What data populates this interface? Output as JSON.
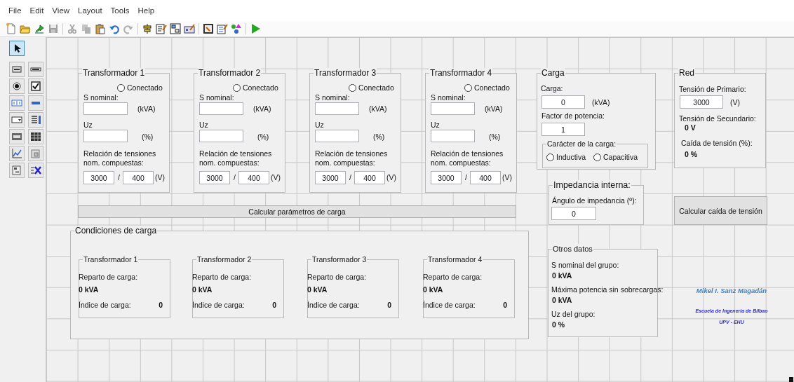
{
  "menu": [
    "File",
    "Edit",
    "View",
    "Layout",
    "Tools",
    "Help"
  ],
  "toolbar_groups": [
    {
      "buttons": [
        {
          "kind": "new",
          "disabled": false
        },
        {
          "kind": "open",
          "disabled": false
        },
        {
          "kind": "export",
          "disabled": false
        },
        {
          "kind": "save",
          "disabled": true
        }
      ]
    },
    {
      "buttons": [
        {
          "kind": "cut",
          "disabled": true
        },
        {
          "kind": "copy",
          "disabled": true
        },
        {
          "kind": "paste",
          "disabled": false
        },
        {
          "kind": "undo",
          "disabled": false
        },
        {
          "kind": "redo",
          "disabled": true
        }
      ]
    },
    {
      "buttons": [
        {
          "kind": "align",
          "disabled": false
        },
        {
          "kind": "menu-editor",
          "disabled": false
        },
        {
          "kind": "tab-order",
          "disabled": false
        },
        {
          "kind": "toolbar-editor",
          "disabled": false
        }
      ]
    },
    {
      "buttons": [
        {
          "kind": "editor",
          "disabled": false
        },
        {
          "kind": "inspector",
          "disabled": false
        },
        {
          "kind": "browser",
          "disabled": false
        }
      ]
    },
    {
      "buttons": [
        {
          "kind": "run",
          "disabled": false
        }
      ]
    }
  ],
  "palette_tools": [
    {
      "kind": "select",
      "selected": true
    },
    {
      "kind": "push-button",
      "selected": false
    },
    {
      "kind": "slider",
      "selected": false
    },
    {
      "kind": "radio",
      "selected": false
    },
    {
      "kind": "checkbox",
      "selected": false
    },
    {
      "kind": "edit",
      "selected": false
    },
    {
      "kind": "static-text",
      "selected": false
    },
    {
      "kind": "popup",
      "selected": false
    },
    {
      "kind": "listbox",
      "selected": false
    },
    {
      "kind": "toggle",
      "selected": false
    },
    {
      "kind": "table",
      "selected": false
    },
    {
      "kind": "axes",
      "selected": false
    },
    {
      "kind": "panel",
      "selected": false
    },
    {
      "kind": "button-group",
      "selected": false
    },
    {
      "kind": "activex",
      "selected": false
    }
  ],
  "transformers": [
    {
      "title": "Transformador 1",
      "connected_label": "Conectado",
      "connected": false,
      "s_nominal_label": "S nominal:",
      "s_nominal_unit": "(kVA)",
      "uz_label": "Uz",
      "uz_unit": "(%)",
      "ratio_label": "Relación de tensiones nom. compuestas:",
      "primary": "3000",
      "separator": "/",
      "secondary": "400",
      "ratio_unit": "(V)"
    },
    {
      "title": "Transformador 2",
      "connected_label": "Conectado",
      "connected": false,
      "s_nominal_label": "S nominal:",
      "s_nominal_unit": "(kVA)",
      "uz_label": "Uz",
      "uz_unit": "(%)",
      "ratio_label": "Relación de tensiones nom. compuestas:",
      "primary": "3000",
      "separator": "/",
      "secondary": "400",
      "ratio_unit": "(V)"
    },
    {
      "title": "Transformador 3",
      "connected_label": "Conectado",
      "connected": false,
      "s_nominal_label": "S nominal:",
      "s_nominal_unit": "(kVA)",
      "uz_label": "Uz",
      "uz_unit": "(%)",
      "ratio_label": "Relación de tensiones nom. compuestas:",
      "primary": "3000",
      "separator": "/",
      "secondary": "400",
      "ratio_unit": "(V)"
    },
    {
      "title": "Transformador 4",
      "connected_label": "Conectado",
      "connected": false,
      "s_nominal_label": "S nominal:",
      "s_nominal_unit": "(kVA)",
      "uz_label": "Uz",
      "uz_unit": "(%)",
      "ratio_label": "Relación de tensiones nom. compuestas:",
      "primary": "3000",
      "separator": "/",
      "secondary": "400",
      "ratio_unit": "(V)"
    }
  ],
  "carga": {
    "title": "Carga",
    "load_label": "Carga:",
    "load_value": "0",
    "load_unit": "(kVA)",
    "pf_label": "Factor de potencia:",
    "pf_value": "1",
    "character": {
      "title": "Carácter de la carga:",
      "options": [
        {
          "label": "Inductiva",
          "selected": false
        },
        {
          "label": "Capacitiva",
          "selected": false
        }
      ]
    }
  },
  "red": {
    "title": "Red",
    "primary_label": "Tensión de Primario:",
    "primary_value": "3000",
    "primary_unit": "(V)",
    "secondary_label": "Tensión de Secundario:",
    "secondary_value": "0 V",
    "drop_label": "Caída de tensión (%):",
    "drop_value": "0 %"
  },
  "calc_load_button": "Calcular parámetros de carga",
  "impedance": {
    "title": "Impedancia interna:",
    "angle_label": "Ángulo de impedancia (º):",
    "angle_value": "0"
  },
  "calc_drop_button": "Calcular caída de tensión",
  "conditions": {
    "title": "Condiciones de carga",
    "panels": [
      {
        "title": "Transformador 1",
        "share_label": "Reparto de carga:",
        "share_value": "0 kVA",
        "index_label": "Índice de carga:",
        "index_value": "0"
      },
      {
        "title": "Transformador 2",
        "share_label": "Reparto de carga:",
        "share_value": "0 kVA",
        "index_label": "Índice de carga:",
        "index_value": "0"
      },
      {
        "title": "Transformador 3",
        "share_label": "Reparto de carga:",
        "share_value": "0 kVA",
        "index_label": "Índice de carga:",
        "index_value": "0"
      },
      {
        "title": "Transformador 4",
        "share_label": "Reparto de carga:",
        "share_value": "0 kVA",
        "index_label": "Índice de carga:",
        "index_value": "0"
      }
    ]
  },
  "other": {
    "title": "Otros datos",
    "items": [
      {
        "label": "S nominal del grupo:",
        "value": "0 kVA"
      },
      {
        "label": "Máxima potencia sin sobrecargas:",
        "value": "0 kVA"
      },
      {
        "label": "Uz del grupo:",
        "value": "0 %"
      }
    ]
  },
  "credits": {
    "author": "Mikel I. Sanz Magadán",
    "school": "Escuela de Ingeneria de Bilbao",
    "university": "UPV - EHU"
  }
}
